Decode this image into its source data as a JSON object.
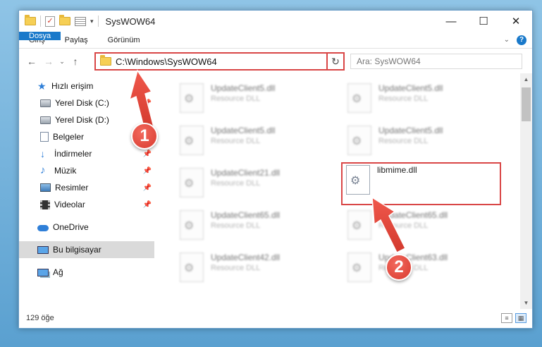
{
  "window": {
    "title": "SysWOW64",
    "controls": {
      "minimize": "—",
      "maximize": "☐",
      "close": "✕"
    }
  },
  "ribbon": {
    "tabs": [
      "Dosya",
      "Giriş",
      "Paylaş",
      "Görünüm"
    ]
  },
  "navigation": {
    "address": "C:\\Windows\\SysWOW64",
    "search_placeholder": "Ara: SysWOW64"
  },
  "sidebar": {
    "quick_access": "Hızlı erişim",
    "items": [
      {
        "label": "Yerel Disk (C:)",
        "icon": "disk-icon",
        "pinned": true
      },
      {
        "label": "Yerel Disk (D:)",
        "icon": "disk-icon",
        "pinned": true
      },
      {
        "label": "Belgeler",
        "icon": "document-icon",
        "pinned": true
      },
      {
        "label": "İndirmeler",
        "icon": "download-icon",
        "pinned": true
      },
      {
        "label": "Müzik",
        "icon": "music-icon",
        "pinned": true
      },
      {
        "label": "Resimler",
        "icon": "pictures-icon",
        "pinned": true
      },
      {
        "label": "Videolar",
        "icon": "video-icon",
        "pinned": true
      }
    ],
    "onedrive": "OneDrive",
    "this_pc": "Bu bilgisayar",
    "network": "Ağ"
  },
  "files": [
    {
      "name": "UpdateClient5.dll",
      "type": "Resource DLL"
    },
    {
      "name": "UpdateClient5.dll",
      "type": "Resource DLL"
    },
    {
      "name": "UpdateClient5.dll",
      "type": "Resource DLL"
    },
    {
      "name": "UpdateClient5.dll",
      "type": "Resource DLL"
    },
    {
      "name": "UpdateClient21.dll",
      "type": "Resource DLL"
    },
    {
      "name": "libmime.dll",
      "type": ""
    },
    {
      "name": "UpdateClient65.dll",
      "type": "Resource DLL"
    },
    {
      "name": "UpdateClient65.dll",
      "type": "Resource DLL"
    },
    {
      "name": "UpdateClient42.dll",
      "type": "Resource DLL"
    },
    {
      "name": "UpdateClient63.dll",
      "type": "Resource DLL"
    }
  ],
  "status": {
    "item_count": "129 öğe"
  },
  "callouts": {
    "step1": "1",
    "step2": "2"
  },
  "colors": {
    "highlight": "#d94646",
    "accent": "#1979ca",
    "callout": "#e04a3e"
  }
}
